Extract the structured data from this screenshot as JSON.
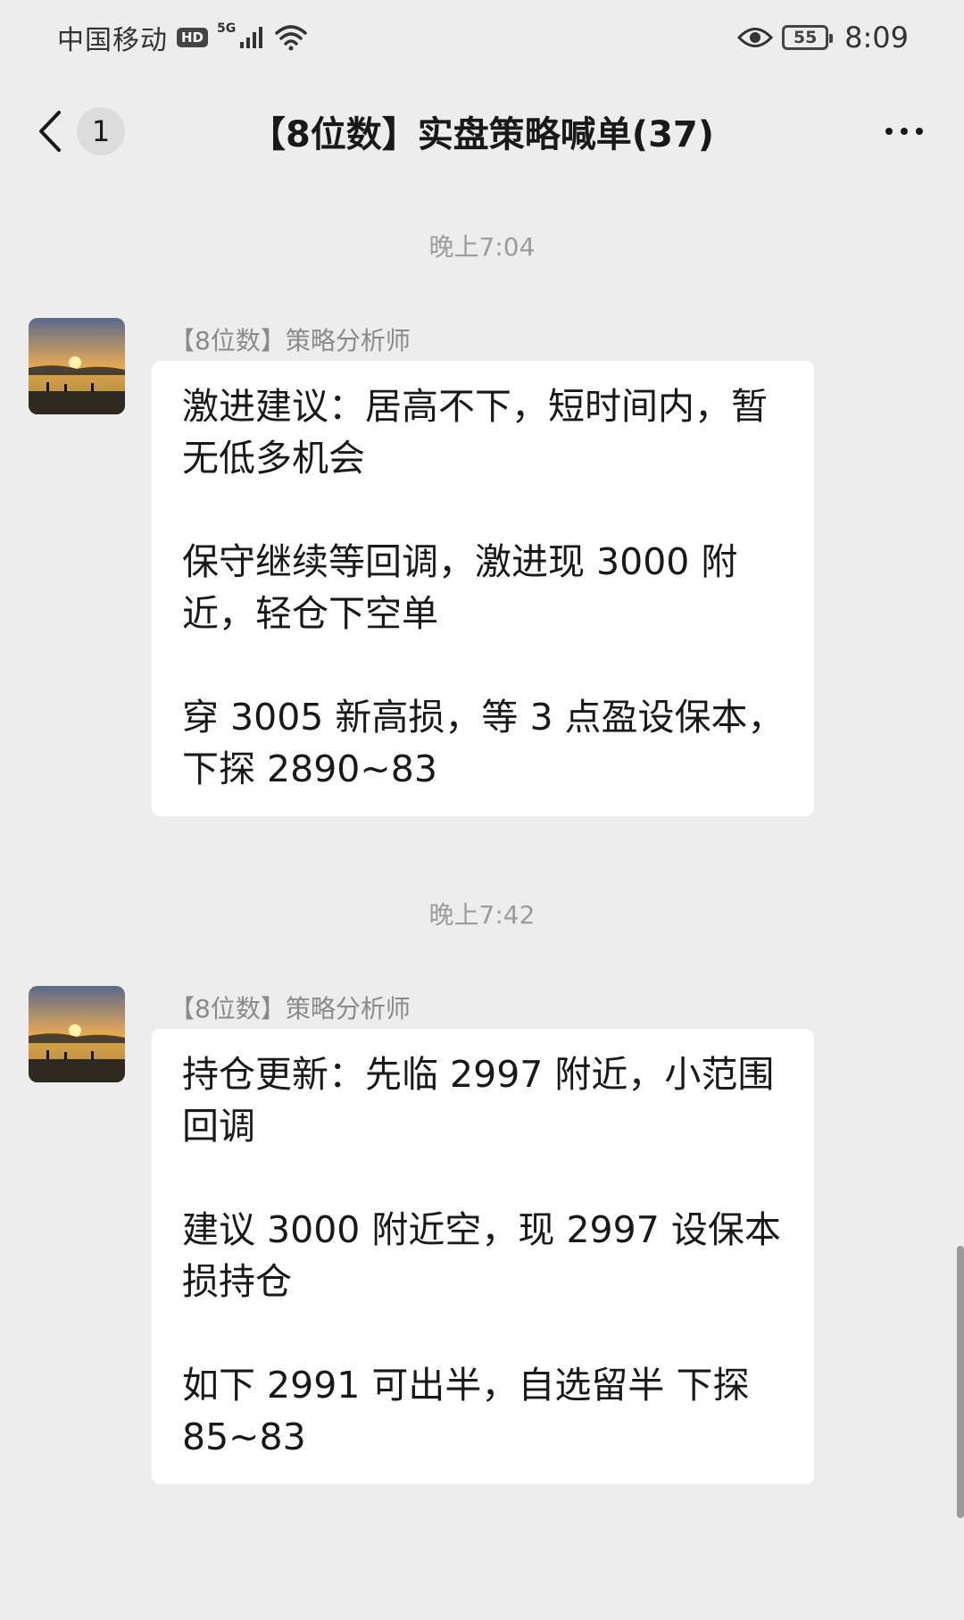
{
  "status_bar": {
    "carrier": "中国移动",
    "hd": "HD",
    "network": "5G",
    "battery": "55",
    "time": "8:09"
  },
  "nav": {
    "unread_count": "1",
    "title": "【8位数】实盘策略喊单(37)"
  },
  "messages": [
    {
      "time": "晚上7:04",
      "sender": "【8位数】策略分析师",
      "paragraphs": [
        "激进建议：居高不下，短时间内，暂无低多机会",
        "保守继续等回调，激进现 3000 附近，轻仓下空单",
        "穿 3005 新高损，等 3 点盈设保本，下探 2890~83"
      ]
    },
    {
      "time": "晚上7:42",
      "sender": "【8位数】策略分析师",
      "paragraphs": [
        "持仓更新：先临 2997 附近，小范围回调",
        "建议 3000 附近空，现 2997 设保本损持仓",
        "如下 2991 可出半，自选留半 下探 85~83"
      ]
    }
  ],
  "colors": {
    "background": "#ededed",
    "bubble": "#ffffff",
    "meta_text": "#9c9c9c"
  },
  "icons": [
    "signal-icon",
    "wifi-icon",
    "eye-icon",
    "battery-icon",
    "back-chevron-icon",
    "more-icon"
  ]
}
